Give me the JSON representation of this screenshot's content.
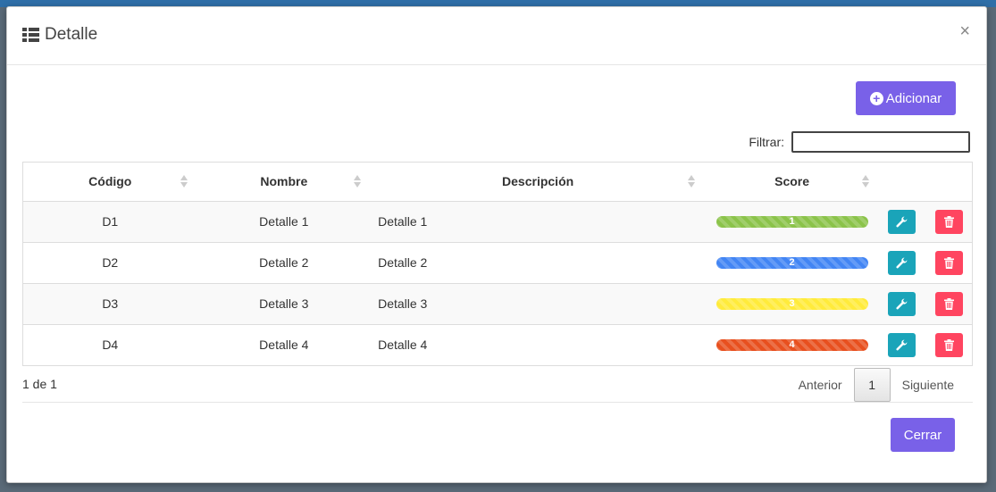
{
  "modal": {
    "title": "Detalle",
    "close_symbol": "×"
  },
  "toolbar": {
    "add_label": "Adicionar",
    "filter_label": "Filtrar:",
    "filter_value": ""
  },
  "table": {
    "columns": [
      "Código",
      "Nombre",
      "Descripción",
      "Score"
    ],
    "rows": [
      {
        "code": "D1",
        "name": "Detalle 1",
        "description": "Detalle 1",
        "score": "1",
        "score_color": "#8bc34a"
      },
      {
        "code": "D2",
        "name": "Detalle 2",
        "description": "Detalle 2",
        "score": "2",
        "score_color": "#4285f4"
      },
      {
        "code": "D3",
        "name": "Detalle 3",
        "description": "Detalle 3",
        "score": "3",
        "score_color": "#ffeb3b"
      },
      {
        "code": "D4",
        "name": "Detalle 4",
        "description": "Detalle 4",
        "score": "4",
        "score_color": "#e8501f"
      }
    ]
  },
  "pagination": {
    "info": "1 de 1",
    "prev_label": "Anterior",
    "current_page": "1",
    "next_label": "Siguiente"
  },
  "footer": {
    "close_label": "Cerrar"
  },
  "icons": {
    "title": "list-icon",
    "add": "plus-circle-icon",
    "edit": "wrench-icon",
    "delete": "trash-icon",
    "sort": "sort-icon"
  },
  "colors": {
    "primary": "#7961e8",
    "edit": "#1aa4b9",
    "delete": "#ff4560"
  }
}
